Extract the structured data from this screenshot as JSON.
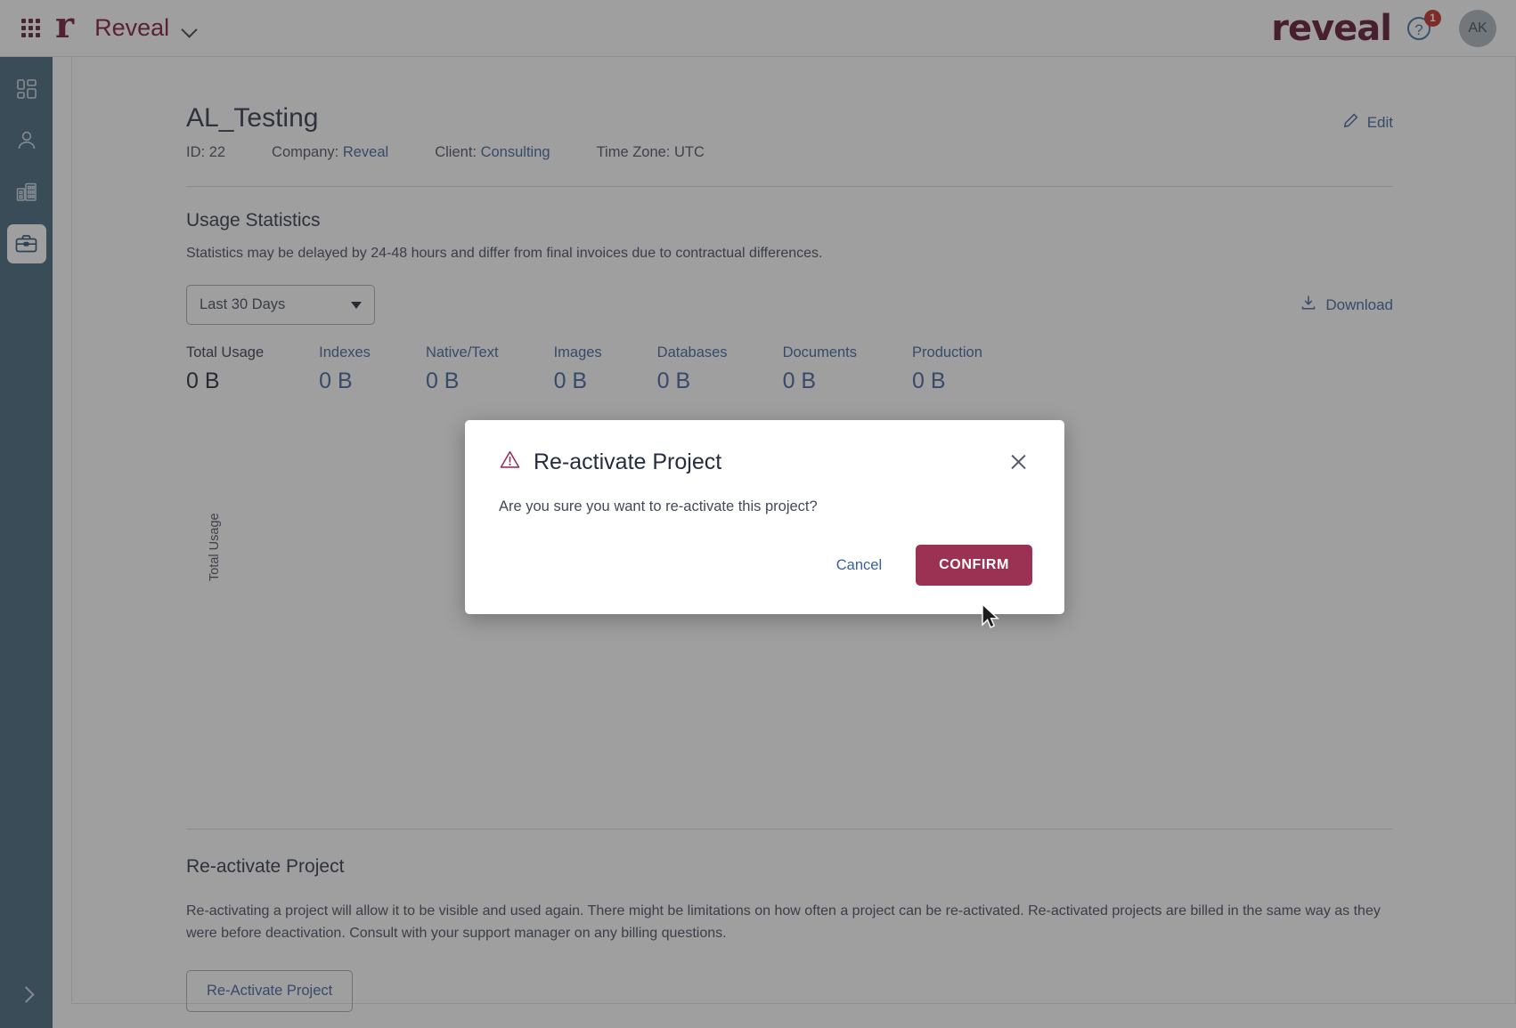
{
  "topbar": {
    "grid_icon": "apps-grid-icon",
    "logo_letter": "r",
    "app_name": "Reveal",
    "chevron_icon": "chevron-down-icon",
    "wordmark": "reveal",
    "help_icon": "help-question-icon",
    "help_symbol": "?",
    "help_badge_count": "1",
    "avatar_initials": "AK"
  },
  "sidebar": {
    "items": [
      {
        "name": "dashboard",
        "icon": "dashboard-grid-icon",
        "active": false
      },
      {
        "name": "users",
        "icon": "person-icon",
        "active": false
      },
      {
        "name": "companies",
        "icon": "buildings-icon",
        "active": false
      },
      {
        "name": "projects",
        "icon": "briefcase-icon",
        "active": true
      }
    ],
    "expand_icon": "chevron-right-icon"
  },
  "page": {
    "title": "AL_Testing",
    "edit_label": "Edit",
    "edit_icon": "pencil-icon",
    "meta": [
      {
        "label": "ID:",
        "value": "22",
        "link": false
      },
      {
        "label": "Company:",
        "value": "Reveal",
        "link": true
      },
      {
        "label": "Client:",
        "value": "Consulting",
        "link": true
      },
      {
        "label": "Time Zone:",
        "value": "UTC",
        "link": false
      }
    ]
  },
  "usage": {
    "section_title": "Usage Statistics",
    "note": "Statistics may be delayed by 24-48 hours and differ from final invoices due to contractual differences.",
    "range_select_value": "Last 30 Days",
    "download_label": "Download",
    "download_icon": "download-icon",
    "chart_y_label": "Total Usage"
  },
  "chart_data": {
    "type": "bar",
    "title": "",
    "xlabel": "",
    "ylabel": "Total Usage",
    "categories": [],
    "values": [],
    "note": "Chart area empty — all usage metrics are 0 B for the selected range"
  },
  "stats": {
    "items": [
      {
        "label": "Total Usage",
        "value": "0 B",
        "is_total": true
      },
      {
        "label": "Indexes",
        "value": "0 B",
        "is_total": false
      },
      {
        "label": "Native/Text",
        "value": "0 B",
        "is_total": false
      },
      {
        "label": "Images",
        "value": "0 B",
        "is_total": false
      },
      {
        "label": "Databases",
        "value": "0 B",
        "is_total": false
      },
      {
        "label": "Documents",
        "value": "0 B",
        "is_total": false
      },
      {
        "label": "Production",
        "value": "0 B",
        "is_total": false
      }
    ]
  },
  "reactivate_section": {
    "title": "Re-activate Project",
    "body": "Re-activating a project will allow it to be visible and used again. There might be limitations on how often a project can be re-activated. Re-activated projects are billed in the same way as they were before deactivation. Consult with your support manager on any billing questions.",
    "button_label": "Re-Activate Project"
  },
  "modal": {
    "title": "Re-activate Project",
    "warning_icon": "warning-triangle-icon",
    "close_icon": "close-icon",
    "message": "Are you sure you want to re-activate this project?",
    "cancel_label": "Cancel",
    "confirm_label": "CONFIRM"
  },
  "colors": {
    "brand_maroon": "#6b1332",
    "confirm_button": "#9c3253",
    "link_blue": "#3b6099",
    "rail_blue": "#3f6279",
    "badge_red": "#c0261d"
  }
}
